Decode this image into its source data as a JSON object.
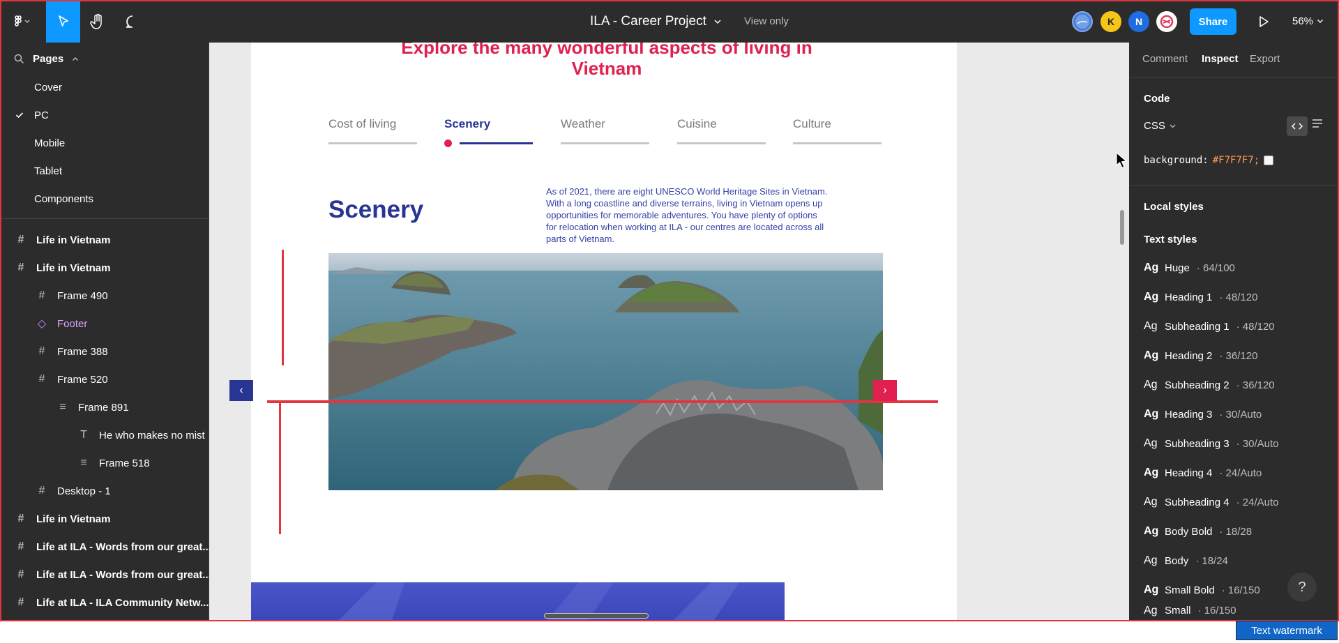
{
  "toolbar": {
    "file_title": "ILA - Career Project",
    "view_mode": "View only",
    "avatar_k": "K",
    "avatar_n": "N",
    "share_label": "Share",
    "zoom": "56%"
  },
  "left_panel": {
    "pages_label": "Pages",
    "pages": [
      {
        "label": "Cover"
      },
      {
        "label": "PC",
        "checked": true
      },
      {
        "label": "Mobile"
      },
      {
        "label": "Tablet"
      },
      {
        "label": "Components"
      }
    ],
    "layers": [
      {
        "label": "Life in Vietnam",
        "icon": "frame-icon"
      },
      {
        "label": "Life in Vietnam",
        "icon": "frame-icon"
      },
      {
        "label": "Frame 490",
        "icon": "frame-icon"
      },
      {
        "label": "Footer",
        "icon": "component-icon"
      },
      {
        "label": "Frame 388",
        "icon": "frame-icon"
      },
      {
        "label": "Frame 520",
        "icon": "frame-icon"
      },
      {
        "label": "Frame 891",
        "icon": "auto-layout-icon"
      },
      {
        "label": "He who makes no mist",
        "icon": "text-icon"
      },
      {
        "label": "Frame 518",
        "icon": "auto-layout-icon"
      },
      {
        "label": "Desktop - 1",
        "icon": "frame-icon"
      },
      {
        "label": "Life in Vietnam",
        "icon": "frame-icon"
      },
      {
        "label": "Life at ILA - Words from our great...",
        "icon": "frame-icon"
      },
      {
        "label": "Life at ILA - Words from our great...",
        "icon": "frame-icon"
      },
      {
        "label": "Life at ILA - ILA Community Netw...",
        "icon": "frame-icon"
      }
    ]
  },
  "canvas": {
    "heading": "Explore the many wonderful aspects of living in Vietnam",
    "tabs": [
      "Cost of living",
      "Scenery",
      "Weather",
      "Cuisine",
      "Culture"
    ],
    "active_tab": "Scenery",
    "section_title": "Scenery",
    "section_description": "As of 2021, there are eight UNESCO World Heritage Sites in Vietnam. With a long coastline and diverse terrains, living in Vietnam opens up opportunities for memorable adventures. You have plenty of options for relocation when working at ILA - our centres are located across all parts of Vietnam.",
    "prev_arrow": "‹",
    "next_arrow": "›",
    "accent_colors": {
      "brand_red": "#e0204f",
      "brand_navy": "#283593"
    }
  },
  "right_panel": {
    "tabs": [
      "Comment",
      "Inspect",
      "Export"
    ],
    "active_tab": "Inspect",
    "code_label": "Code",
    "language": "CSS",
    "css_property": "background:",
    "css_value": "#F7F7F7;",
    "local_styles_label": "Local styles",
    "text_styles_label": "Text styles",
    "text_styles": [
      {
        "name": "Huge",
        "meta": "· 64/100",
        "bold": true
      },
      {
        "name": "Heading 1",
        "meta": "· 48/120",
        "bold": true
      },
      {
        "name": "Subheading 1",
        "meta": "· 48/120",
        "bold": false
      },
      {
        "name": "Heading 2",
        "meta": "· 36/120",
        "bold": true
      },
      {
        "name": "Subheading 2",
        "meta": "· 36/120",
        "bold": false
      },
      {
        "name": "Heading 3",
        "meta": "· 30/Auto",
        "bold": true
      },
      {
        "name": "Subheading 3",
        "meta": "· 30/Auto",
        "bold": false
      },
      {
        "name": "Heading 4",
        "meta": "· 24/Auto",
        "bold": true
      },
      {
        "name": "Subheading 4",
        "meta": "· 24/Auto",
        "bold": false
      },
      {
        "name": "Body Bold",
        "meta": "· 18/28",
        "bold": true
      },
      {
        "name": "Body",
        "meta": "· 18/24",
        "bold": false
      },
      {
        "name": "Small Bold",
        "meta": "· 16/150",
        "bold": true
      },
      {
        "name": "Small",
        "meta": "· 16/150",
        "bold": false
      }
    ],
    "text_style_prefix": "Ag",
    "help": "?"
  },
  "watermark": "Text watermark"
}
